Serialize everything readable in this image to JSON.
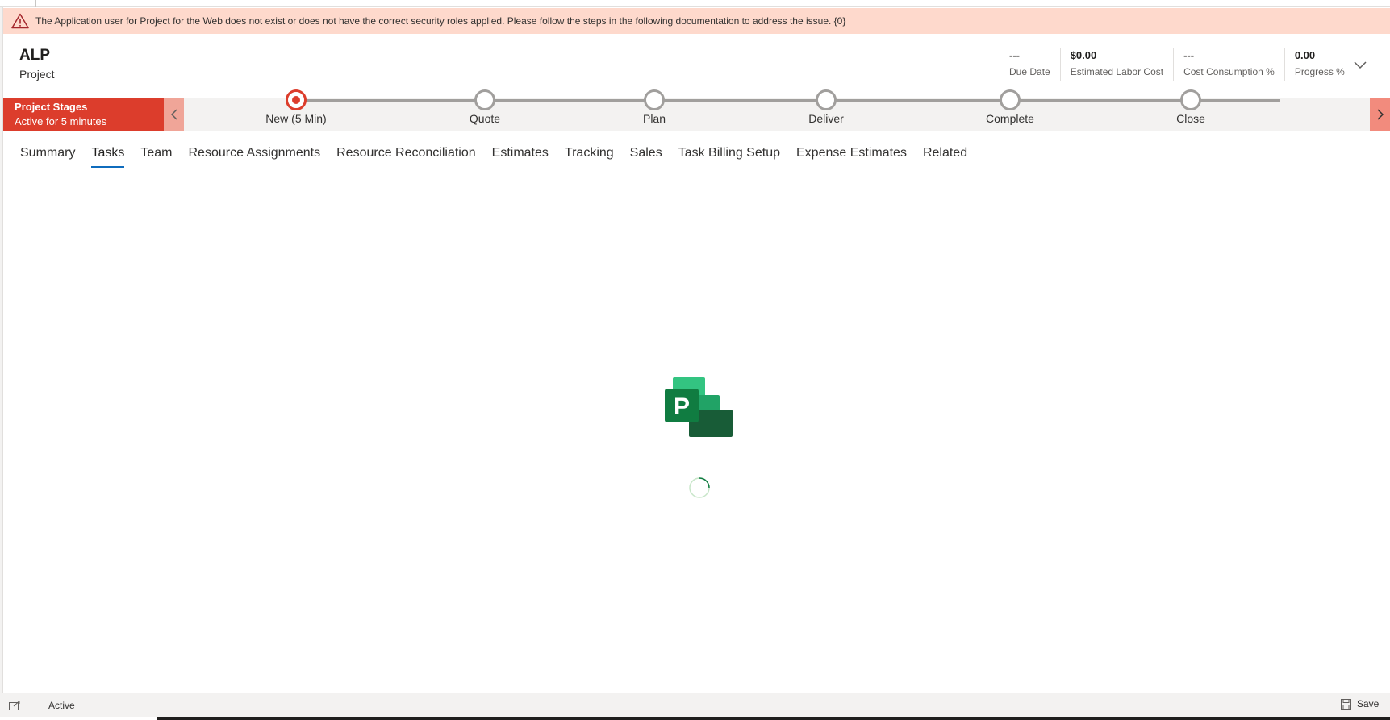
{
  "banner": {
    "message": "The Application user for Project for the Web does not exist or does not have the correct security roles applied. Please follow the steps in the following documentation to address the issue. {0}",
    "icon": "warning-icon",
    "background": "#fed9cc"
  },
  "header": {
    "title": "ALP",
    "subtitle": "Project",
    "kpis": [
      {
        "value": "---",
        "label": "Due Date"
      },
      {
        "value": "$0.00",
        "label": "Estimated Labor Cost"
      },
      {
        "value": "---",
        "label": "Cost Consumption %"
      },
      {
        "value": "0.00",
        "label": "Progress %"
      }
    ]
  },
  "process": {
    "name": "Project Stages",
    "active_for": "Active for 5 minutes",
    "accent": "#dc3d2c",
    "stages": [
      {
        "name": "New  (5 Min)",
        "active": true
      },
      {
        "name": "Quote",
        "active": false
      },
      {
        "name": "Plan",
        "active": false
      },
      {
        "name": "Deliver",
        "active": false
      },
      {
        "name": "Complete",
        "active": false
      },
      {
        "name": "Close",
        "active": false
      }
    ]
  },
  "tabs": {
    "selected": "Tasks",
    "items": [
      "Summary",
      "Tasks",
      "Team",
      "Resource Assignments",
      "Resource Reconciliation",
      "Estimates",
      "Tracking",
      "Sales",
      "Task Billing Setup",
      "Expense Estimates",
      "Related"
    ]
  },
  "content": {
    "logo": "project-logo-icon",
    "loading_icon": "loading-spinner-icon"
  },
  "statusbar": {
    "status": "Active",
    "save_label": "Save"
  }
}
